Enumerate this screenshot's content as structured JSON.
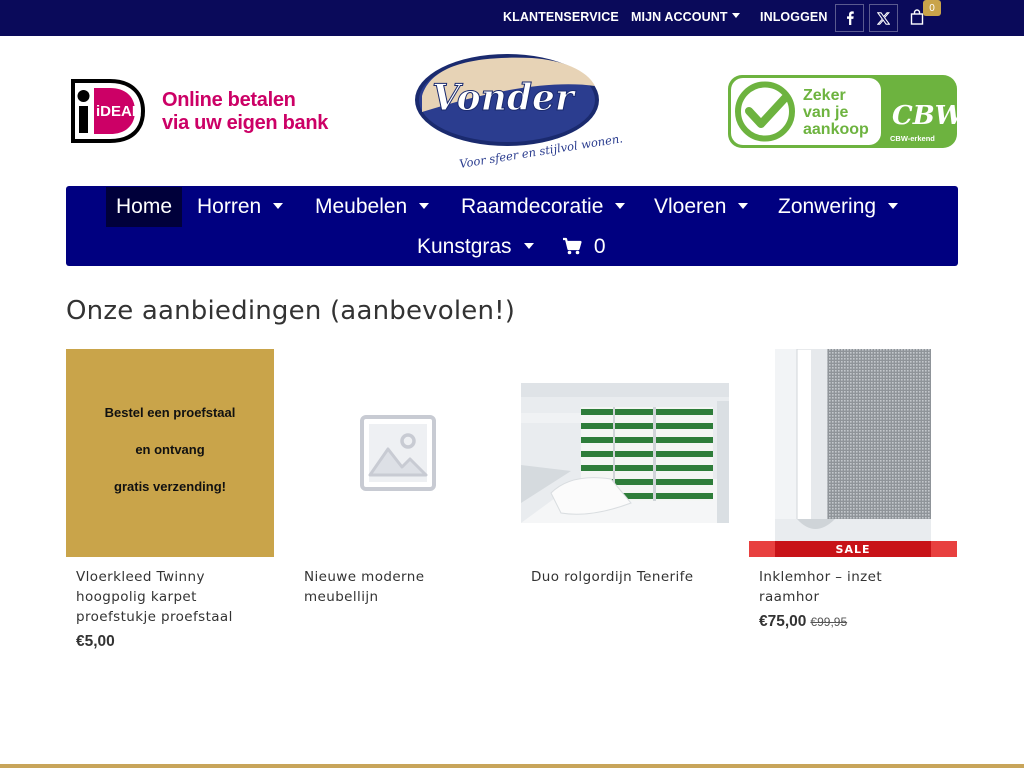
{
  "topbar": {
    "customer_service": "KLANTENSERVICE",
    "my_account": "MIJN ACCOUNT",
    "login": "INLOGGEN",
    "facebook_icon": "facebook-icon",
    "x_icon": "x-twitter-icon",
    "cart_icon": "shopping-bag-icon",
    "cart_count": "0"
  },
  "header": {
    "ideal_logo_text": "iDEAL",
    "ideal_line1": "Online betalen",
    "ideal_line2": "via uw eigen bank",
    "brand_name": "Vonder",
    "brand_tagline": "Voor sfeer en stijlvol wonen.",
    "cbw_line1": "Zeker",
    "cbw_line2": "van je",
    "cbw_line3": "aankoop",
    "cbw_badge": "CBW-erkend"
  },
  "nav": {
    "items": [
      {
        "label": "Home",
        "active": true
      },
      {
        "label": "Horren",
        "dropdown": true
      },
      {
        "label": "Meubelen",
        "dropdown": true
      },
      {
        "label": "Raamdecoratie",
        "dropdown": true
      },
      {
        "label": "Vloeren",
        "dropdown": true
      },
      {
        "label": "Zonwering",
        "dropdown": true
      },
      {
        "label": "Kunstgras",
        "dropdown": true
      }
    ],
    "cart_icon": "cart-icon",
    "cart_count": "0"
  },
  "section": {
    "title": "Onze aanbiedingen (aanbevolen!)"
  },
  "products": [
    {
      "name": "Vloerkleed Twinny hoogpolig karpet proefstukje proefstaal",
      "price": "€5,00",
      "image_text": [
        "Bestel een proefstaal",
        "en ontvang",
        "gratis verzending!"
      ]
    },
    {
      "name": "Nieuwe moderne meubellijn",
      "image_icon": "placeholder-image-icon"
    },
    {
      "name": "Duo rolgordijn Tenerife"
    },
    {
      "name": "Inklemhor – inzet raamhor",
      "price": "€75,00",
      "old_price": "€99,95",
      "sale_label": "SALE"
    }
  ],
  "colors": {
    "topbar": "#0a0a5a",
    "nav": "#000080",
    "nav_active": "#00003a",
    "ideal_pink": "#cc0066",
    "cbw_green": "#6db33f",
    "sale_red": "#c81318",
    "accent_gold": "#c9a44a"
  }
}
